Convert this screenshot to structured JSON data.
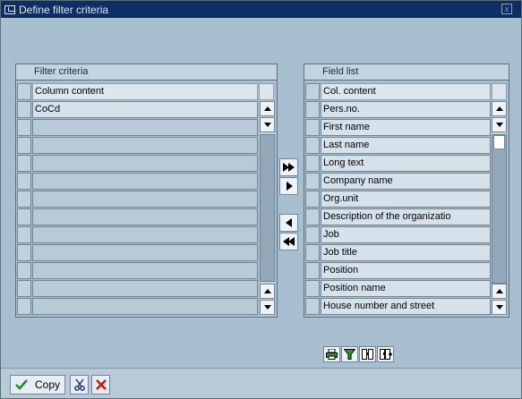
{
  "window": {
    "title": "Define filter criteria",
    "close_glyph": "x"
  },
  "filter_panel": {
    "title": "Filter criteria",
    "column_header": "Column content",
    "rows": [
      "CoCd",
      "",
      "",
      "",
      "",
      "",
      "",
      "",
      "",
      "",
      "",
      ""
    ]
  },
  "field_panel": {
    "title": "Field list",
    "column_header": "Col. content",
    "rows": [
      "Pers.no.",
      "First name",
      "Last name",
      "Long text",
      "Company name",
      "Org.unit",
      "Description of the organizatio",
      "Job",
      "Job title",
      "Position",
      "Position name",
      "House number and street"
    ]
  },
  "transfer_buttons": [
    "move-all-right",
    "move-right",
    "move-left",
    "move-all-left"
  ],
  "field_tools": [
    "print-icon",
    "filter-icon",
    "find-icon",
    "find-next-icon"
  ],
  "footer": {
    "copy_label": "Copy"
  },
  "colors": {
    "title_bar": "#0e2f64",
    "background": "#a8bfcf",
    "cancel_red": "#d01010",
    "confirm_green": "#1f8a2a"
  }
}
